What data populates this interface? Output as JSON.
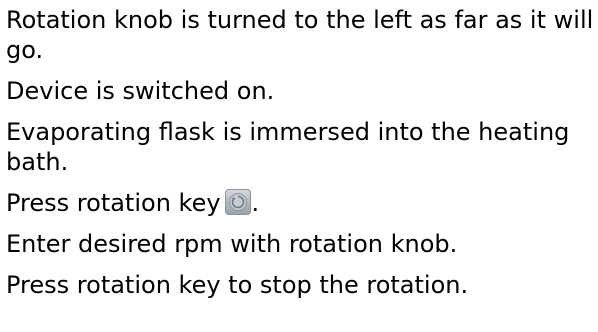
{
  "instructions": {
    "step1": "Rotation knob is turned to the left as far as it will go.",
    "step2": "Device is switched on.",
    "step3": "Evaporating flask is immersed into the heating bath.",
    "step4_before": "Press rotation key",
    "step4_icon": "rotation-key-icon",
    "step4_after": ".",
    "step5": "Enter desired rpm with rotation knob.",
    "step6": "Press rotation key to stop the rotation."
  }
}
